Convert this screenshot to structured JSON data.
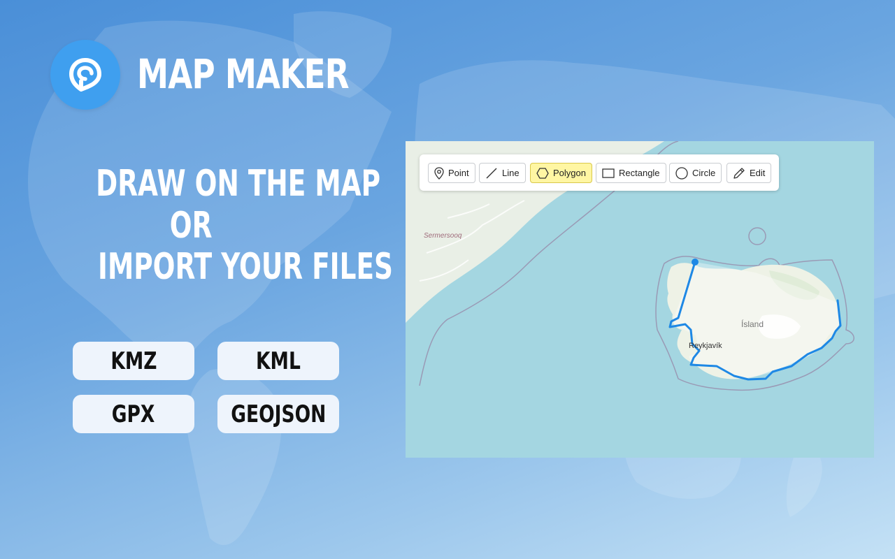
{
  "brand": {
    "name": "MAP MAKER",
    "logo_icon": "map-pin-icon"
  },
  "headline": {
    "line1": "DRAW ON THE MAP",
    "line2": "OR",
    "line3": "IMPORT YOUR FILES"
  },
  "formats": [
    "KMZ",
    "KML",
    "GPX",
    "GEOJSON"
  ],
  "toolbar": {
    "tools": [
      {
        "label": "Point",
        "icon": "pin-icon",
        "active": false
      },
      {
        "label": "Line",
        "icon": "line-icon",
        "active": false
      },
      {
        "label": "Polygon",
        "icon": "hexagon-icon",
        "active": true
      },
      {
        "label": "Rectangle",
        "icon": "rectangle-icon",
        "active": false
      },
      {
        "label": "Circle",
        "icon": "circle-icon",
        "active": false
      },
      {
        "label": "Edit",
        "icon": "pencil-icon",
        "active": false
      }
    ]
  },
  "map": {
    "labels": {
      "region": "Sermersooq",
      "country": "Ísland",
      "city": "Reykjavík"
    },
    "colors": {
      "water": "#a4d6e1",
      "land": "#eef2e6",
      "drawn_line": "#1e88e5",
      "active_tool": "#fff6a3"
    }
  },
  "colors": {
    "background_top": "#4a8fd8",
    "background_bottom": "#c4e1f5",
    "logo": "#3f9fef",
    "format_button": "#eef4fc"
  }
}
